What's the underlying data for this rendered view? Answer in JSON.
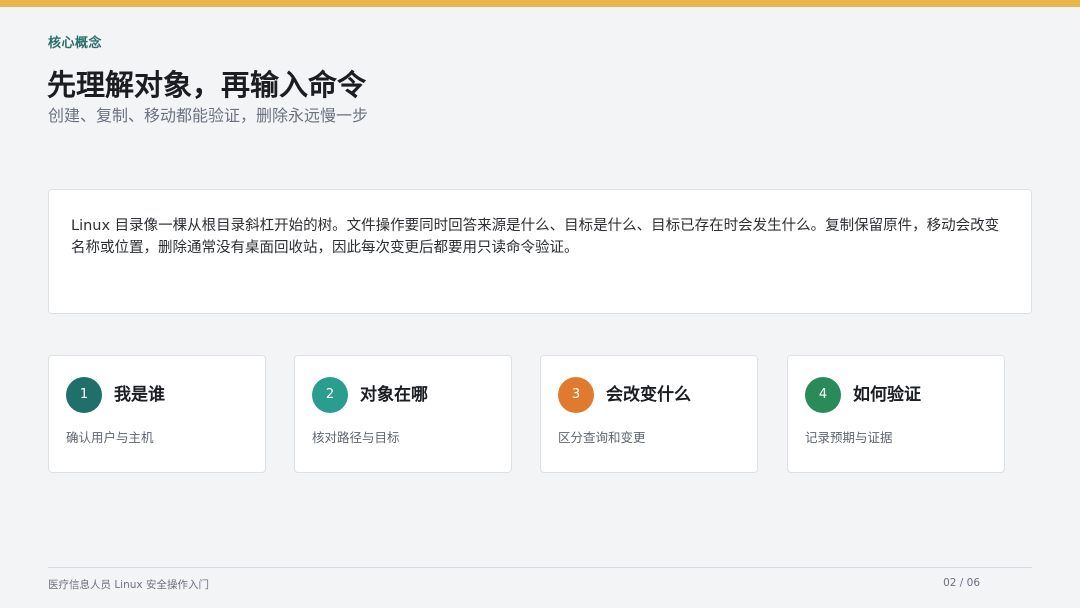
{
  "header": {
    "eyebrow": "核心概念",
    "title": "先理解对象，再输入命令",
    "subtitle": "创建、复制、移动都能验证，删除永远慢一步"
  },
  "intro": {
    "text": "Linux 目录像一棵从根目录斜杠开始的树。文件操作要同时回答来源是什么、目标是什么、目标已存在时会发生什么。复制保留原件，移动会改变名称或位置，删除通常没有桌面回收站，因此每次变更后都要用只读命令验证。"
  },
  "cards": [
    {
      "number": "1",
      "title": "我是谁",
      "desc": "确认用户与主机",
      "color": "#1f6f6b"
    },
    {
      "number": "2",
      "title": "对象在哪",
      "desc": "核对路径与目标",
      "color": "#2a9d8f"
    },
    {
      "number": "3",
      "title": "会改变什么",
      "desc": "区分查询和变更",
      "color": "#e07a2f"
    },
    {
      "number": "4",
      "title": "如何验证",
      "desc": "记录预期与证据",
      "color": "#2a8a5a"
    }
  ],
  "footer": {
    "left": "医疗信息人员 Linux 安全操作入门",
    "page": "02 / 06"
  },
  "colors": {
    "accent_bar": "#e8b64b",
    "eyebrow": "#2a6f6a"
  }
}
